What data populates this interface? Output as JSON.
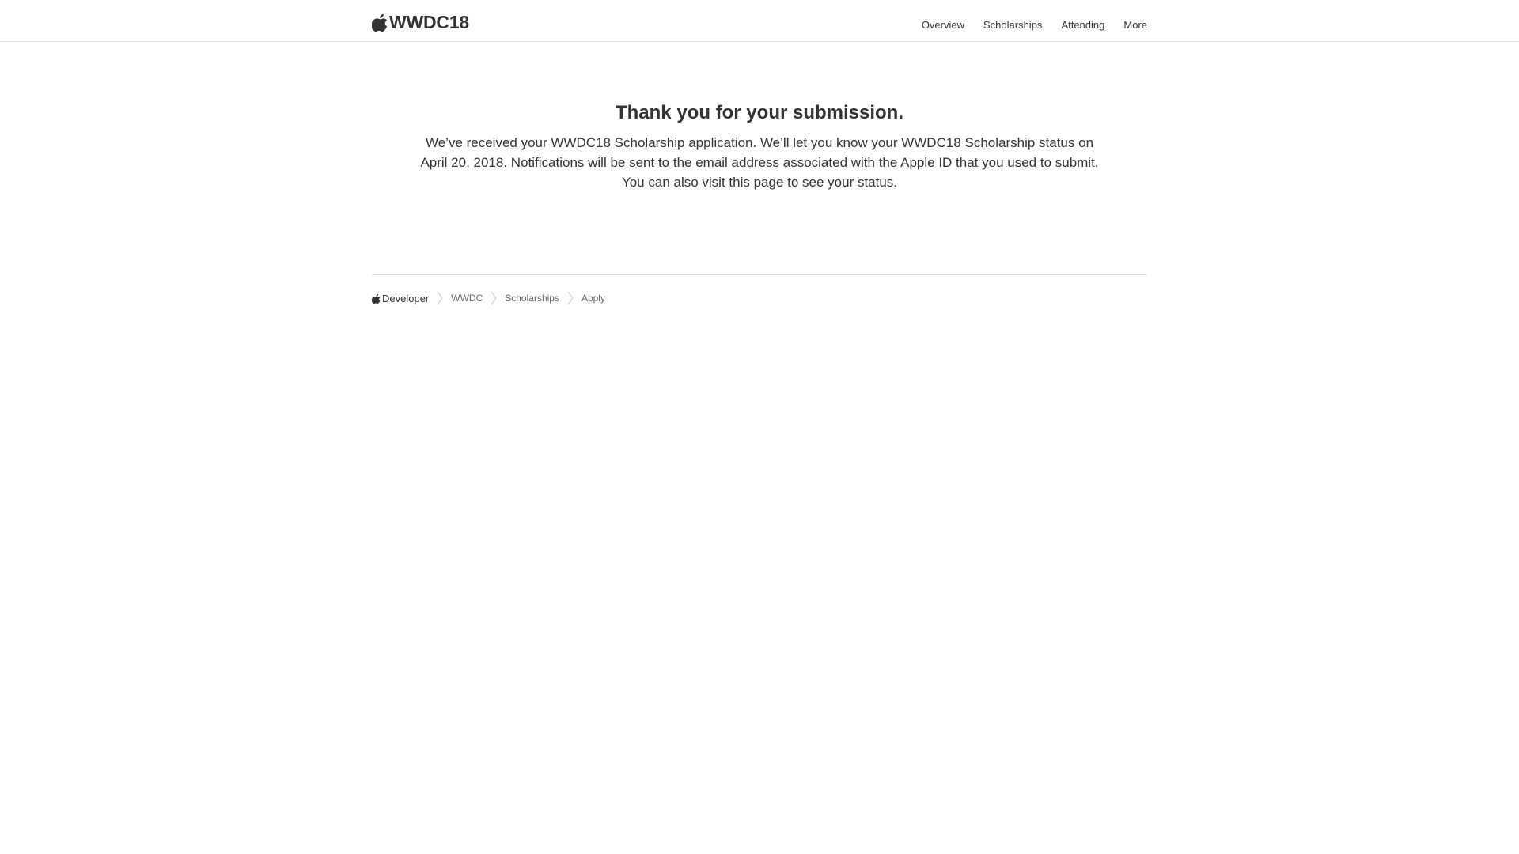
{
  "header": {
    "logo_icon": "apple-logo-icon",
    "title": "WWDC18",
    "nav": [
      {
        "label": "Overview"
      },
      {
        "label": "Scholarships"
      },
      {
        "label": "Attending"
      },
      {
        "label": "More"
      }
    ]
  },
  "main": {
    "title": "Thank you for your submission.",
    "message": "We’ve received your WWDC18 Scholarship application. We’ll let you know your WWDC18 Scholarship status on April 20, 2018. Notifications will be sent to the email address associated with the Apple ID that you used to submit. You can also visit this page to see your status."
  },
  "footer": {
    "breadcrumb": {
      "root_icon": "apple-logo-icon",
      "root_label": "Developer",
      "separator_icon": "chevron-right-icon",
      "items": [
        {
          "label": "WWDC"
        },
        {
          "label": "Scholarships"
        },
        {
          "label": "Apply"
        }
      ]
    }
  },
  "colors": {
    "text": "#333333",
    "secondary_text": "#666666",
    "divider": "#e5e5e5",
    "background": "#ffffff"
  }
}
